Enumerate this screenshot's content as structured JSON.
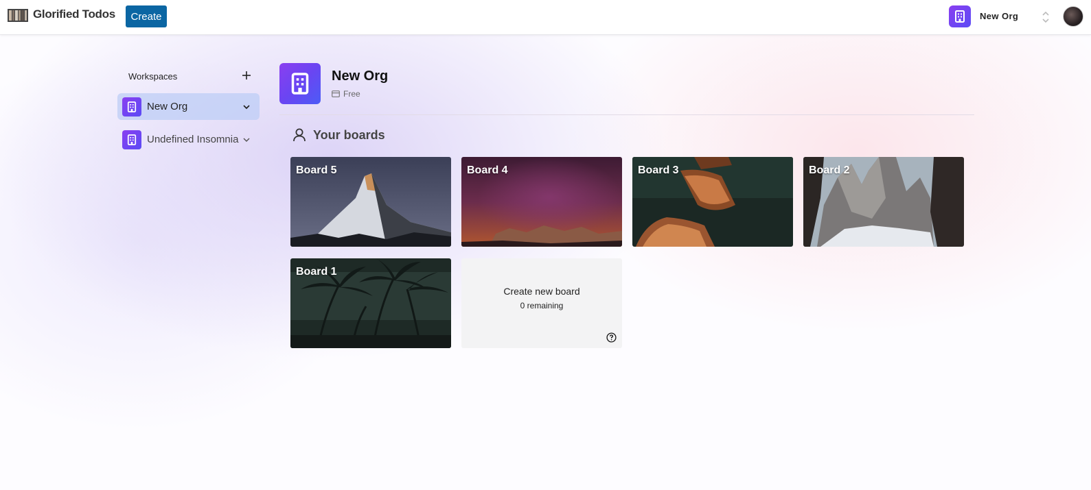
{
  "app": {
    "name": "Glorified Todos",
    "create_label": "Create"
  },
  "org_switcher": {
    "name": "New Org"
  },
  "sidebar": {
    "title": "Workspaces",
    "items": [
      {
        "label": "New Org",
        "active": true
      },
      {
        "label": "Undefined Insomnia",
        "active": false
      }
    ]
  },
  "org_header": {
    "name": "New Org",
    "plan": "Free"
  },
  "boards": {
    "heading": "Your boards",
    "items": [
      {
        "label": "Board 5"
      },
      {
        "label": "Board 4"
      },
      {
        "label": "Board 3"
      },
      {
        "label": "Board 2"
      },
      {
        "label": "Board 1"
      }
    ],
    "new_board": {
      "title": "Create new board",
      "remaining": "0 remaining"
    }
  },
  "colors": {
    "create_button": "#0b66a3",
    "org_gradient_start": "#8a3ff0",
    "org_gradient_end": "#5b4bf5",
    "active_workspace_bg": "#bfcdf5"
  }
}
